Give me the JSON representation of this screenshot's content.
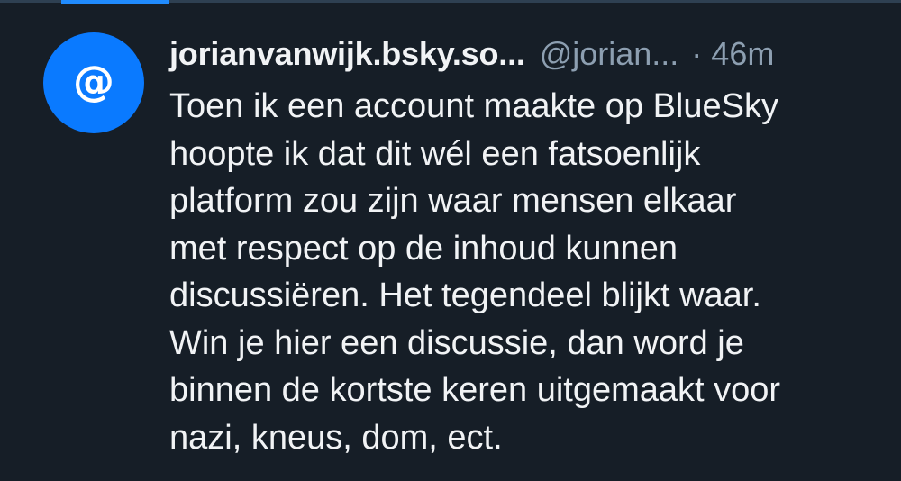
{
  "post": {
    "avatar_symbol": "@",
    "avatar_icon": "at-sign-icon",
    "avatar_color": "#0a7aff",
    "display_name": "jorianvanwijk.bsky.so...",
    "handle": "@jorian...",
    "separator": "·",
    "timestamp": "46m",
    "text_lines": [
      "Toen ik een account maakte op BlueSky",
      "hoopte ik dat dit wél een fatsoenlijk",
      "platform zou zijn waar mensen elkaar",
      "met respect op de inhoud kunnen",
      "discussiëren. Het tegendeel blijkt waar.",
      "Win je hier een discussie, dan word je",
      "binnen de kortste keren uitgemaakt voor",
      "nazi, kneus, dom, ect."
    ]
  },
  "colors": {
    "background": "#161e27",
    "text_primary": "#f1f3f5",
    "text_secondary": "#8d9fb1",
    "accent": "#208bfe"
  }
}
